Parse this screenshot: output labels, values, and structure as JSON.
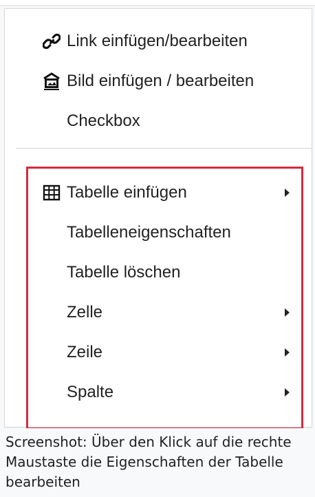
{
  "menu": {
    "items": [
      {
        "label": "Link einfügen/bearbeiten",
        "icon": "link-icon",
        "submenu": false
      },
      {
        "label": "Bild einfügen / bearbeiten",
        "icon": "image-icon",
        "submenu": false
      },
      {
        "label": "Checkbox",
        "icon": "",
        "submenu": false
      },
      {
        "label": "Tabelle einfügen",
        "icon": "table-icon",
        "submenu": true
      },
      {
        "label": "Tabelleneigenschaften",
        "icon": "",
        "submenu": false
      },
      {
        "label": "Tabelle löschen",
        "icon": "",
        "submenu": false
      },
      {
        "label": "Zelle",
        "icon": "",
        "submenu": true
      },
      {
        "label": "Zeile",
        "icon": "",
        "submenu": true
      },
      {
        "label": "Spalte",
        "icon": "",
        "submenu": true
      }
    ]
  },
  "caption": {
    "text": "Screenshot: Über den Klick auf die rechte Maustaste die Eigenschaften der Tabelle bearbeiten"
  },
  "colors": {
    "highlight_border": "#d6293f",
    "text": "#222222",
    "caption_background": "#f8f9fa"
  }
}
